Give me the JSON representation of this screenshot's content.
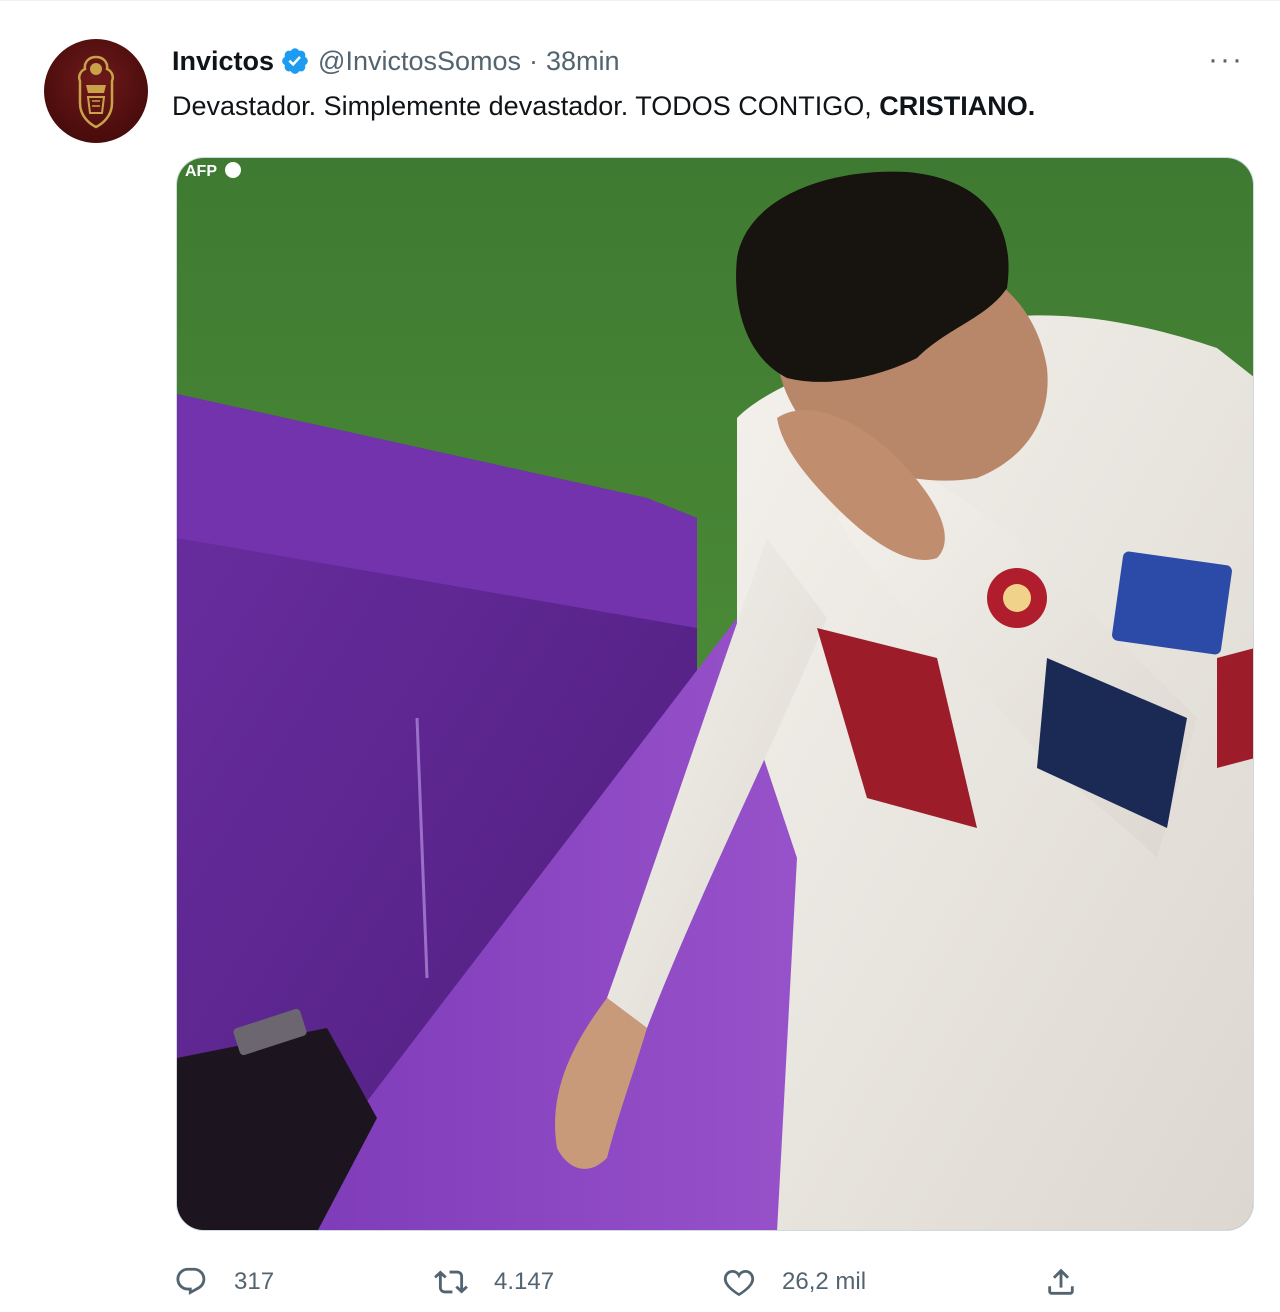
{
  "tweet": {
    "author_name": "Invictos",
    "handle": "@InvictosSomos",
    "separator": "·",
    "time": "38min",
    "more_label": "···",
    "text_plain": "Devastador. Simplemente devastador. TODOS CONTIGO, ",
    "text_bold": "CRISTIANO.",
    "media_watermark": "AFP",
    "stats": {
      "replies": "317",
      "retweets": "4.147",
      "likes": "26,2 mil"
    }
  },
  "icons": {
    "verified": "verified-badge-icon",
    "reply": "reply-icon",
    "retweet": "retweet-icon",
    "like": "heart-icon",
    "share": "share-icon",
    "more": "more-icon"
  },
  "colors": {
    "verified_blue": "#1d9bf0",
    "text_primary": "#0f1419",
    "text_secondary": "#536471",
    "avatar_bg": "#4b0c0c"
  }
}
